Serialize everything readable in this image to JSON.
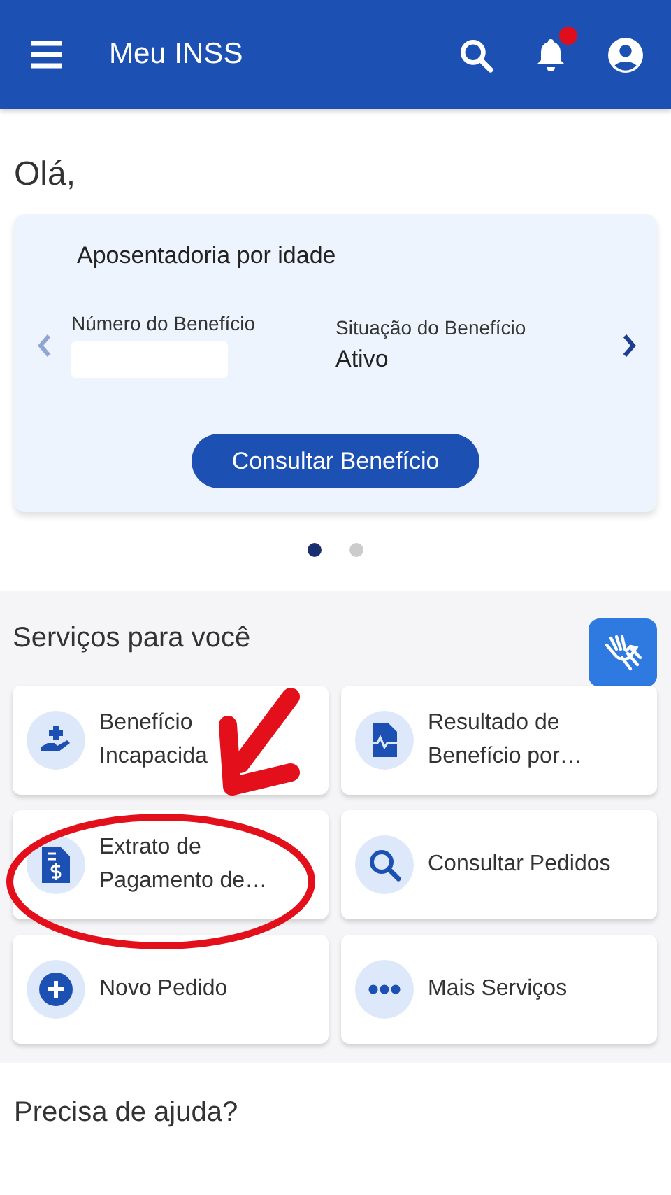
{
  "app_bar": {
    "title": "Meu INSS",
    "notification_badge": true
  },
  "greeting": "Olá,",
  "benefit_card": {
    "title": "Aposentadoria por idade",
    "number_label": "Número do Benefício",
    "status_label": "Situação do Benefício",
    "status_value": "Ativo",
    "button": "Consultar Benefício"
  },
  "carousel_pages": [
    {
      "selected": true
    },
    {
      "selected": false
    }
  ],
  "services": {
    "title": "Serviços para você",
    "items": [
      {
        "kind": "hand-plus",
        "label": "Benefício\nIncapacida"
      },
      {
        "kind": "document-pulse",
        "label": "Resultado de\nBenefício por…"
      },
      {
        "kind": "document-money",
        "label": "Extrato de\nPagamento de…"
      },
      {
        "kind": "search",
        "label": "Consultar Pedidos"
      },
      {
        "kind": "plus",
        "label": "Novo Pedido"
      },
      {
        "kind": "more",
        "label": "Mais Serviços"
      }
    ]
  },
  "help": {
    "title": "Precisa de ajuda?"
  }
}
